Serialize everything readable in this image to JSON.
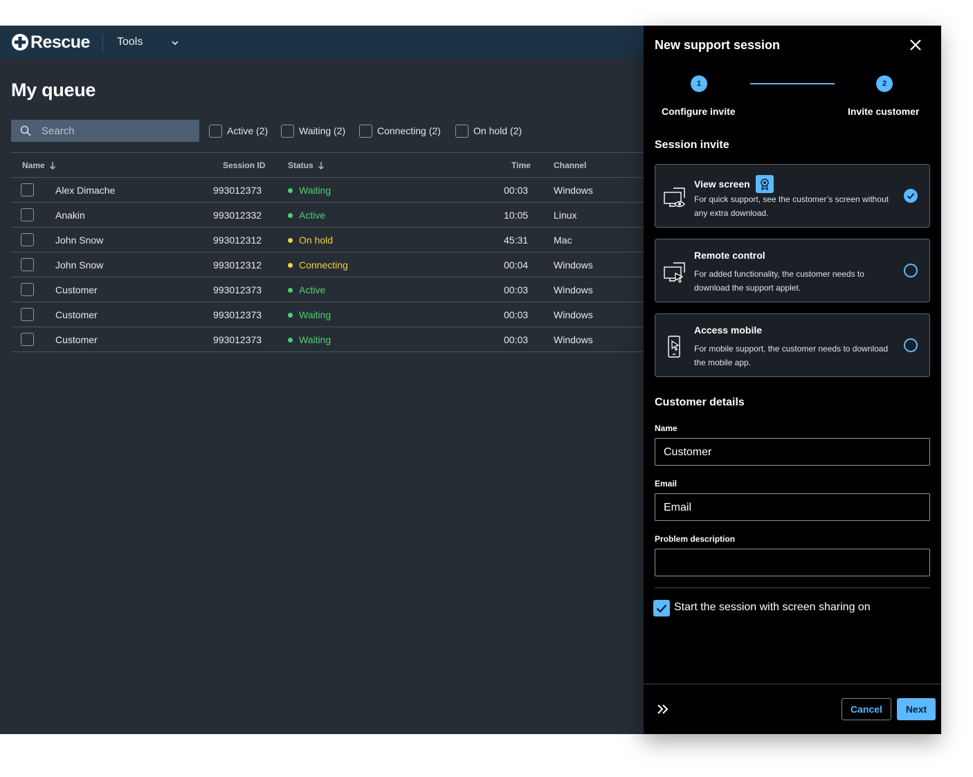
{
  "app": {
    "logo_text": "Rescue",
    "menu_label": "Tools",
    "page_title": "My queue"
  },
  "search": {
    "placeholder": "Search"
  },
  "filters": [
    {
      "label": "Active (2)"
    },
    {
      "label": "Waiting (2)"
    },
    {
      "label": "Connecting (2)"
    },
    {
      "label": "On hold (2)"
    }
  ],
  "table": {
    "columns": {
      "name": "Name",
      "session_id": "Session ID",
      "status": "Status",
      "time": "Time",
      "channel": "Channel"
    },
    "rows": [
      {
        "name": "Alex Dimache",
        "session_id": "993012373",
        "status": "Waiting",
        "time": "00:03",
        "channel": "Windows"
      },
      {
        "name": "Anakin",
        "session_id": "993012332",
        "status": "Active",
        "time": "10:05",
        "channel": "Linux"
      },
      {
        "name": "John Snow",
        "session_id": "993012312",
        "status": "On hold",
        "time": "45:31",
        "channel": "Mac"
      },
      {
        "name": "John Snow",
        "session_id": "993012312",
        "status": "Connecting",
        "time": "00:04",
        "channel": "Windows"
      },
      {
        "name": "Customer",
        "session_id": "993012373",
        "status": "Active",
        "time": "00:03",
        "channel": "Windows"
      },
      {
        "name": "Customer",
        "session_id": "993012373",
        "status": "Waiting",
        "time": "00:03",
        "channel": "Windows"
      },
      {
        "name": "Customer",
        "session_id": "993012373",
        "status": "Waiting",
        "time": "00:03",
        "channel": "Windows"
      }
    ]
  },
  "status_colors": {
    "Waiting": "#4fcf70",
    "Active": "#4fcf70",
    "On hold": "#f3d13a",
    "Connecting": "#f3d13a"
  },
  "panel": {
    "title": "New support session",
    "steps": [
      {
        "number": "1",
        "label": "Configure invite"
      },
      {
        "number": "2",
        "label": "Invite customer"
      }
    ],
    "session_invite_title": "Session invite",
    "options": [
      {
        "title": "View screen",
        "description": "For quick support, see the customer’s screen without any extra download.",
        "selected": true,
        "icon": "monitor-eye-icon"
      },
      {
        "title": "Remote control",
        "description": "For added functionality, the customer needs to download the support applet.",
        "selected": false,
        "icon": "monitor-cursor-icon"
      },
      {
        "title": "Access mobile",
        "description": "For mobile support, the customer needs to download the mobile app.",
        "selected": false,
        "icon": "mobile-cursor-icon"
      }
    ],
    "customer_details_title": "Customer details",
    "fields": {
      "name_label": "Name",
      "name_value": "Customer",
      "email_label": "Email",
      "email_placeholder": "Email",
      "problem_label": "Problem description",
      "problem_value": ""
    },
    "screen_sharing_label": "Start the session with screen sharing on",
    "screen_sharing_checked": true,
    "cancel_label": "Cancel",
    "next_label": "Next"
  },
  "colors": {
    "accent": "#5cb8ff",
    "header_bg": "#1c3346",
    "content_bg": "#262d35",
    "panel_bg": "#000000"
  }
}
